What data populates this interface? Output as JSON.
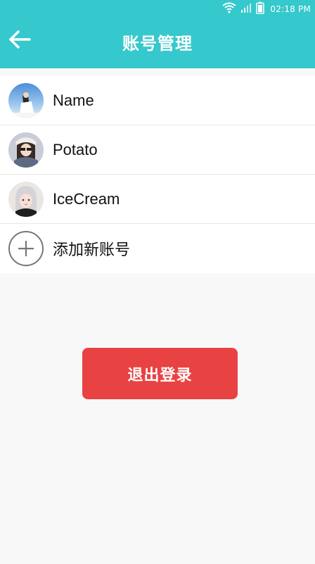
{
  "status_bar": {
    "time": "02:18 PM",
    "icons": [
      "wifi-icon",
      "signal-icon",
      "battery-icon"
    ]
  },
  "header": {
    "title": "账号管理",
    "back_icon": "arrow-left-icon"
  },
  "accounts": [
    {
      "name": "Name",
      "avatar": "avatar-girl-blue"
    },
    {
      "name": "Potato",
      "avatar": "avatar-girl-white-hat"
    },
    {
      "name": "IceCream",
      "avatar": "avatar-girl-silver-hair"
    }
  ],
  "add_account": {
    "label": "添加新账号",
    "icon": "plus-circle-icon"
  },
  "logout": {
    "label": "退出登录"
  },
  "colors": {
    "primary": "#35c8cc",
    "danger": "#e94242",
    "background": "#f8f8f8"
  }
}
